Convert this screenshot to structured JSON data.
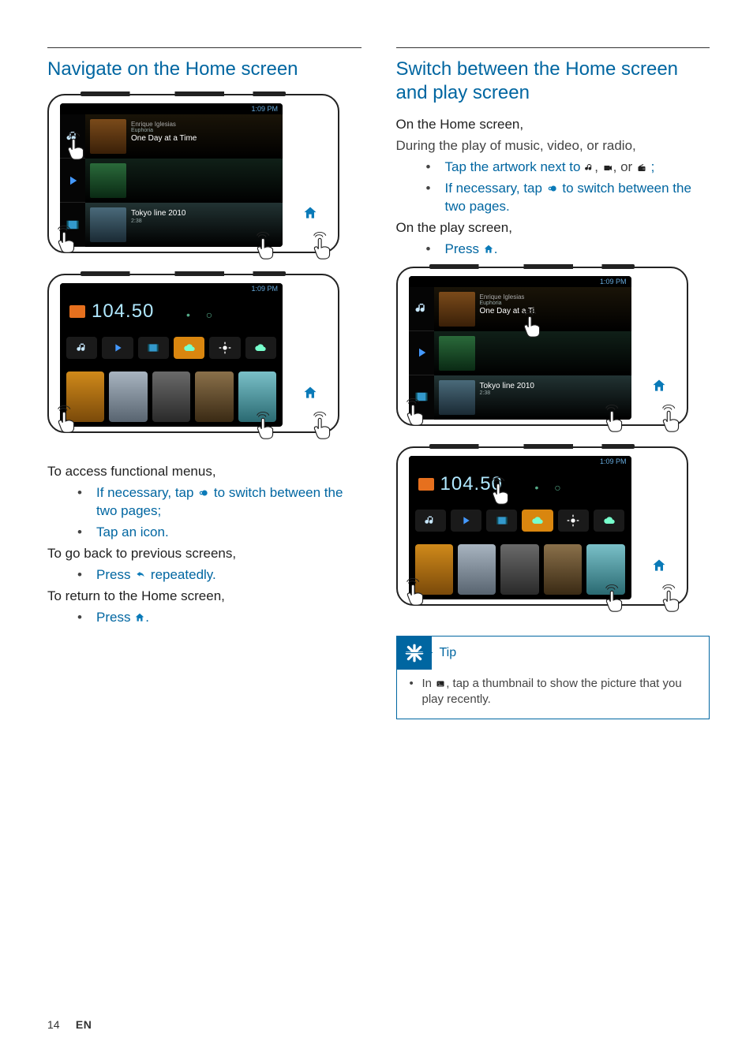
{
  "footer": {
    "page_number": "14",
    "lang": "EN"
  },
  "left": {
    "heading": "Navigate on the Home screen",
    "device1": {
      "status_time": "1:09 PM",
      "music": {
        "artist": "Enrique Iglesias",
        "album": "Euphoria",
        "track": "One Day at a Time"
      },
      "video": {
        "title": "Tokyo line 2010",
        "duration": "2:38"
      }
    },
    "device2": {
      "status_time": "1:09 PM",
      "radio_freq": "104.50"
    },
    "s1": {
      "label": "To access functional menus,"
    },
    "s1_items": [
      {
        "pre": "If necessary, tap ",
        "post": " to switch between the two pages;"
      },
      {
        "text": "Tap an icon."
      }
    ],
    "s2": {
      "label": "To go back to previous screens,"
    },
    "s2_items": [
      {
        "pre": "Press ",
        "post": " repeatedly."
      }
    ],
    "s3": {
      "label": "To return to the Home screen,"
    },
    "s3_items": [
      {
        "pre": "Press ",
        "post": "."
      }
    ]
  },
  "right": {
    "heading": "Switch between the Home screen and play screen",
    "p1": "On the Home screen,",
    "p2": "During the play of music, video, or radio,",
    "r1_items": [
      {
        "pre": "Tap the artwork next to ",
        "mid1": ", ",
        "mid2": ", or ",
        "post": " ;"
      },
      {
        "pre": "If necessary, tap ",
        "post": " to switch between the two pages."
      }
    ],
    "p3": "On the play screen,",
    "r2_items": [
      {
        "pre": "Press ",
        "post": "."
      }
    ],
    "deviceA": {
      "status_time": "1:09 PM",
      "music": {
        "artist": "Enrique Iglesias",
        "album": "Euphoria",
        "track": "One Day at a Ti"
      },
      "video": {
        "title": "Tokyo line 2010",
        "duration": "2:38"
      }
    },
    "deviceB": {
      "status_time": "1:09 PM",
      "radio_freq": "104.50"
    },
    "tip": {
      "label": "Tip",
      "item_pre": "In ",
      "item_post": ", tap a thumbnail to show the picture that you play recently."
    }
  }
}
